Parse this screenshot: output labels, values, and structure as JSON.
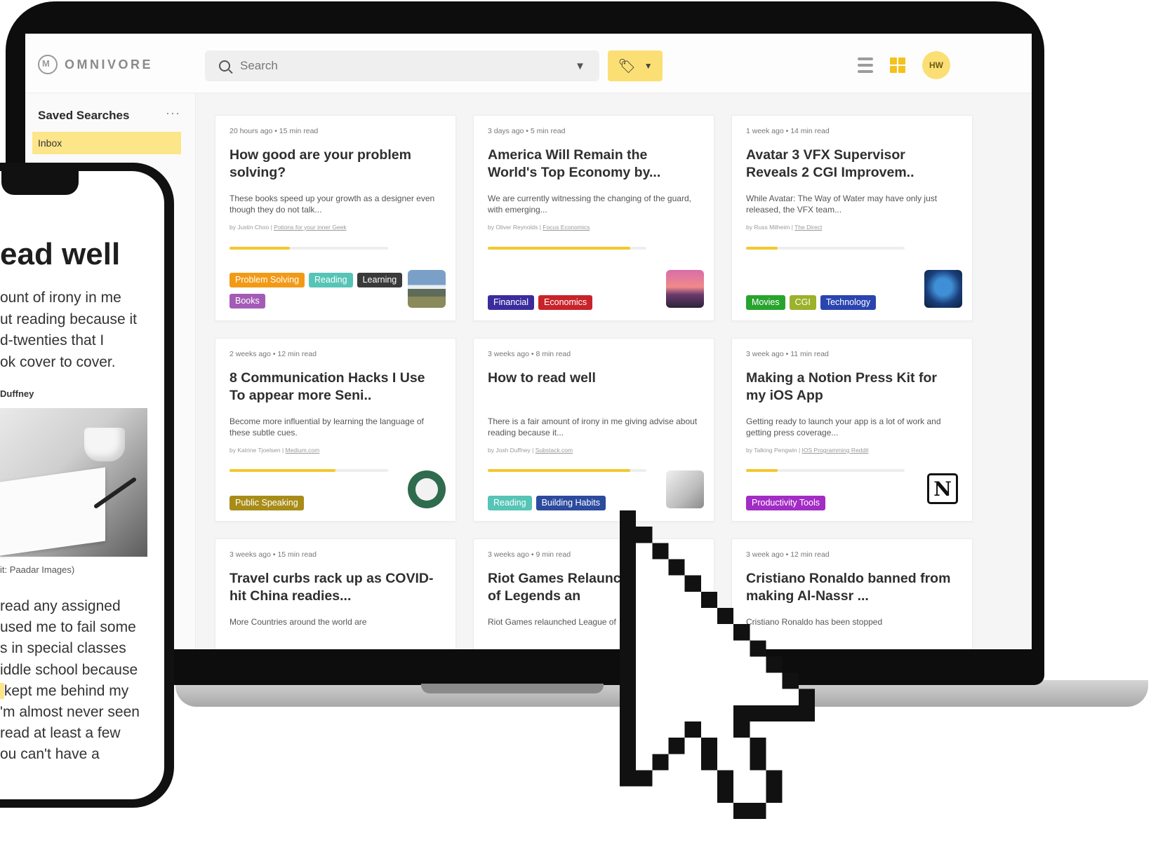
{
  "topbar": {
    "logo_text": "OMNIVORE",
    "search_placeholder": "Search",
    "avatar_initials": "HW"
  },
  "sidebar": {
    "title": "Saved Searches",
    "more": "···",
    "items": [
      {
        "label": "Inbox"
      }
    ]
  },
  "cards": [
    {
      "meta": "20 hours ago  •  15 min read",
      "title": "How good are your problem solving?",
      "desc": "These books speed up your growth as a designer even though they do not talk...",
      "byline_author": "by Justin Choo | ",
      "byline_source": "Potions for your inner Geek",
      "progress": 0.38,
      "tags": [
        {
          "label": "Problem Solving",
          "color": "#f29a16"
        },
        {
          "label": "Reading",
          "color": "#56c4b6"
        },
        {
          "label": "Learning",
          "color": "#3a3a3a"
        },
        {
          "label": "Books",
          "color": "#a45bb6"
        }
      ],
      "thumb": "mountain-landscape"
    },
    {
      "meta": "3 days ago  •  5 min read",
      "title": "America Will Remain the World's Top  Economy by...",
      "desc": "We are currently witnessing the changing of the guard, with emerging...",
      "byline_author": "by Oliver Reynolds | ",
      "byline_source": "Focus Economics",
      "progress": 0.9,
      "tags": [
        {
          "label": "Financial",
          "color": "#3b2c9e"
        },
        {
          "label": "Economics",
          "color": "#c9232a"
        }
      ],
      "thumb": "sunset-sky"
    },
    {
      "meta": "1 week ago  •  14 min read",
      "title": "Avatar 3 VFX Supervisor Reveals 2 CGI Improvem..",
      "desc": "While Avatar: The Way of Water may have only just released, the VFX team...",
      "byline_author": "by Russ Milheim | ",
      "byline_source": "The Direct",
      "progress": 0.2,
      "tags": [
        {
          "label": "Movies",
          "color": "#27a42e"
        },
        {
          "label": "CGI",
          "color": "#9bb22a"
        },
        {
          "label": "Technology",
          "color": "#2a45b0"
        }
      ],
      "thumb": "avatar-face"
    },
    {
      "meta": "2 weeks ago  •  12 min read",
      "title": "8 Communication Hacks I Use To appear more Seni..",
      "desc": "Become more influential by learning the language of these subtle cues.",
      "byline_author": "by Katrine Tjoelsen | ",
      "byline_source": "Medium.com",
      "progress": 0.67,
      "tags": [
        {
          "label": "Public Speaking",
          "color": "#a88c17"
        }
      ],
      "thumb": "people-talking"
    },
    {
      "meta": "3 weeks ago  •  8 min read",
      "title": "How to read well",
      "desc": "There is a fair amount of irony in me giving advise about reading because it...",
      "byline_author": "by Josh Duffney | ",
      "byline_source": "Substack.com",
      "progress": 0.9,
      "tags": [
        {
          "label": "Reading",
          "color": "#56c4b6"
        },
        {
          "label": "Building Habits",
          "color": "#2c4a9e"
        }
      ],
      "thumb": "open-book"
    },
    {
      "meta": "3 week ago  •  11 min read",
      "title": "Making a Notion Press Kit for my iOS App",
      "desc": "Getting ready to launch your app is a lot of work and getting press coverage...",
      "byline_author": "by Talking Pengwin | ",
      "byline_source": "IOS Programming Reddit",
      "progress": 0.2,
      "tags": [
        {
          "label": "Productivity Tools",
          "color": "#a22cc4"
        }
      ],
      "thumb": "notion-logo"
    },
    {
      "meta": "3 weeks ago  •  15 min read",
      "title": "Travel curbs rack up as COVID-hit China readies...",
      "desc": "More Countries around the world are",
      "byline_author": "",
      "byline_source": "",
      "progress": 0,
      "tags": [],
      "thumb": ""
    },
    {
      "meta": "3 weeks ago  •  9 min read",
      "title": "Riot Games Relaunche League of Legends an",
      "desc": "Riot Games relaunched League of",
      "byline_author": "",
      "byline_source": "",
      "progress": 0,
      "tags": [],
      "thumb": ""
    },
    {
      "meta": "3 week ago  •  12 min read",
      "title": "Cristiano Ronaldo banned from making Al-Nassr ...",
      "desc": "Cristiano Ronaldo has been stopped",
      "byline_author": "",
      "byline_source": "",
      "progress": 0,
      "tags": [],
      "thumb": ""
    }
  ],
  "phone": {
    "title": "ead well",
    "para": "ount of irony in me\nut reading because it\nd-twenties that I\nok cover to cover.",
    "author": "Duffney",
    "caption": "it: Paadar Images)",
    "body_lines": [
      "read any assigned",
      "used me to fail some",
      "s in special classes",
      "iddle school because",
      "kept me behind my",
      "'m almost never seen",
      "read at least a few",
      "ou can't have a"
    ]
  }
}
